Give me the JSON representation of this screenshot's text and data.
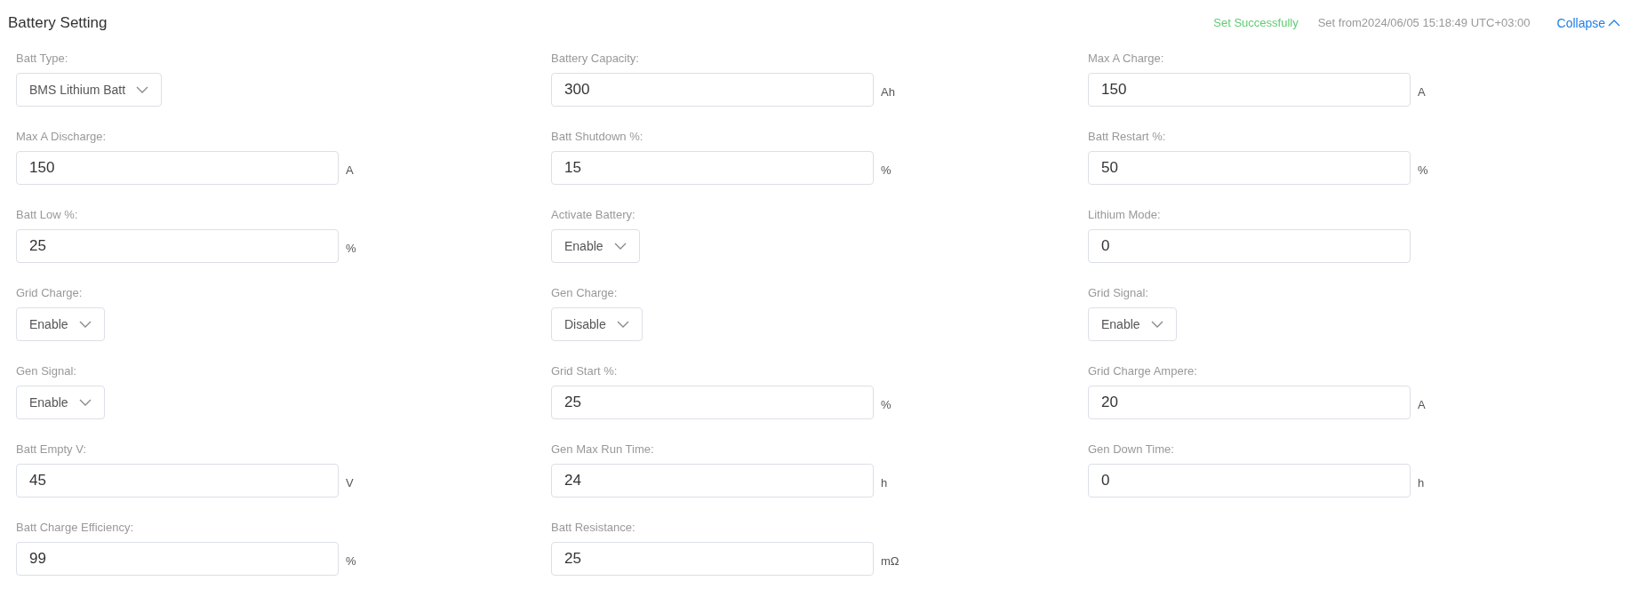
{
  "title": "Battery Setting",
  "status": {
    "result": "Set Successfully",
    "timestamp": "Set from2024/06/05 15:18:49 UTC+03:00",
    "toggle": "Collapse",
    "expanded": true
  },
  "fields": [
    {
      "label": "Batt Type:",
      "kind": "select",
      "value": "BMS Lithium Batt"
    },
    {
      "label": "Battery Capacity:",
      "kind": "input",
      "value": "300",
      "unit": "Ah"
    },
    {
      "label": "Max A Charge:",
      "kind": "input",
      "value": "150",
      "unit": "A"
    },
    {
      "label": "Max A Discharge:",
      "kind": "input",
      "value": "150",
      "unit": "A"
    },
    {
      "label": "Batt Shutdown %:",
      "kind": "input",
      "value": "15",
      "unit": "%"
    },
    {
      "label": "Batt Restart %:",
      "kind": "input",
      "value": "50",
      "unit": "%"
    },
    {
      "label": "Batt Low %:",
      "kind": "input",
      "value": "25",
      "unit": "%"
    },
    {
      "label": "Activate Battery:",
      "kind": "select",
      "value": "Enable"
    },
    {
      "label": "Lithium Mode:",
      "kind": "input",
      "value": "0"
    },
    {
      "label": "Grid Charge:",
      "kind": "select",
      "value": "Enable"
    },
    {
      "label": "Gen Charge:",
      "kind": "select",
      "value": "Disable"
    },
    {
      "label": "Grid Signal:",
      "kind": "select",
      "value": "Enable"
    },
    {
      "label": "Gen Signal:",
      "kind": "select",
      "value": "Enable"
    },
    {
      "label": "Grid Start %:",
      "kind": "input",
      "value": "25",
      "unit": "%"
    },
    {
      "label": "Grid Charge Ampere:",
      "kind": "input",
      "value": "20",
      "unit": "A"
    },
    {
      "label": "Batt Empty V:",
      "kind": "input",
      "value": "45",
      "unit": "V"
    },
    {
      "label": "Gen Max Run Time:",
      "kind": "input",
      "value": "24",
      "unit": "h"
    },
    {
      "label": "Gen Down Time:",
      "kind": "input",
      "value": "0",
      "unit": "h"
    },
    {
      "label": "Batt Charge Efficiency:",
      "kind": "input",
      "value": "99",
      "unit": "%"
    },
    {
      "label": "Batt Resistance:",
      "kind": "input",
      "value": "25",
      "unit": "mΩ"
    }
  ]
}
